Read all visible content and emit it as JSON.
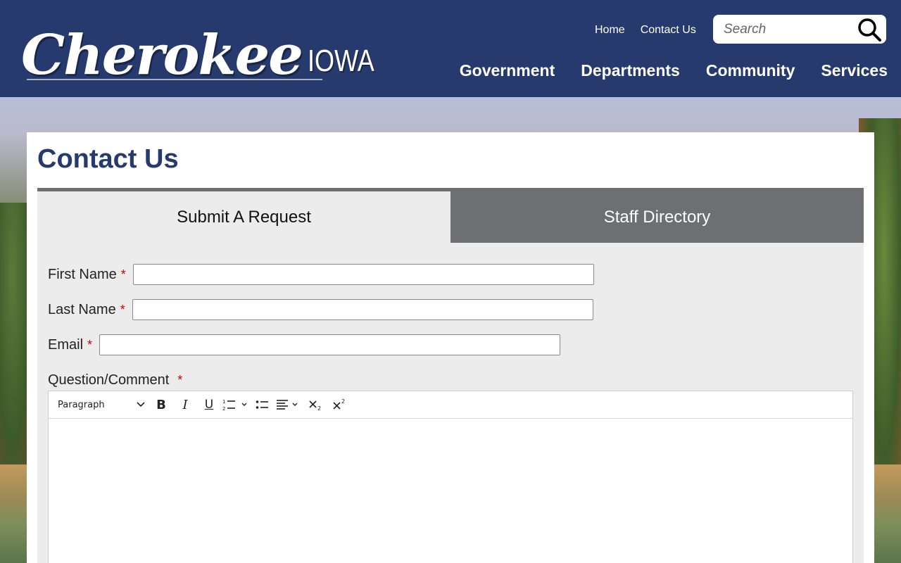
{
  "site": {
    "logo_script": "Cherokee",
    "logo_state": "IOWA"
  },
  "utility_nav": [
    {
      "label": "Home"
    },
    {
      "label": "Contact Us"
    }
  ],
  "search": {
    "placeholder": "Search",
    "icon": "search-icon"
  },
  "main_nav": [
    {
      "label": "Government"
    },
    {
      "label": "Departments"
    },
    {
      "label": "Community"
    },
    {
      "label": "Services"
    }
  ],
  "page": {
    "title": "Contact Us"
  },
  "tabs": [
    {
      "label": "Submit A Request",
      "active": true
    },
    {
      "label": "Staff Directory",
      "active": false
    }
  ],
  "form": {
    "required_marker": "*",
    "first_name": {
      "label": "First Name",
      "value": ""
    },
    "last_name": {
      "label": "Last Name",
      "value": ""
    },
    "email": {
      "label": "Email",
      "value": ""
    },
    "question": {
      "label": "Question/Comment",
      "value": ""
    }
  },
  "editor_toolbar": {
    "block_format": "Paragraph",
    "buttons": [
      "bold-icon",
      "italic-icon",
      "underline-icon",
      "numbered-list-icon",
      "bullet-list-icon",
      "align-icon",
      "subscript-icon",
      "superscript-icon"
    ]
  },
  "colors": {
    "header_bg": "#263a6e",
    "title": "#263a6e",
    "tab_inactive": "#6d6f73",
    "form_bg": "#ececec",
    "required": "#cc0000"
  }
}
